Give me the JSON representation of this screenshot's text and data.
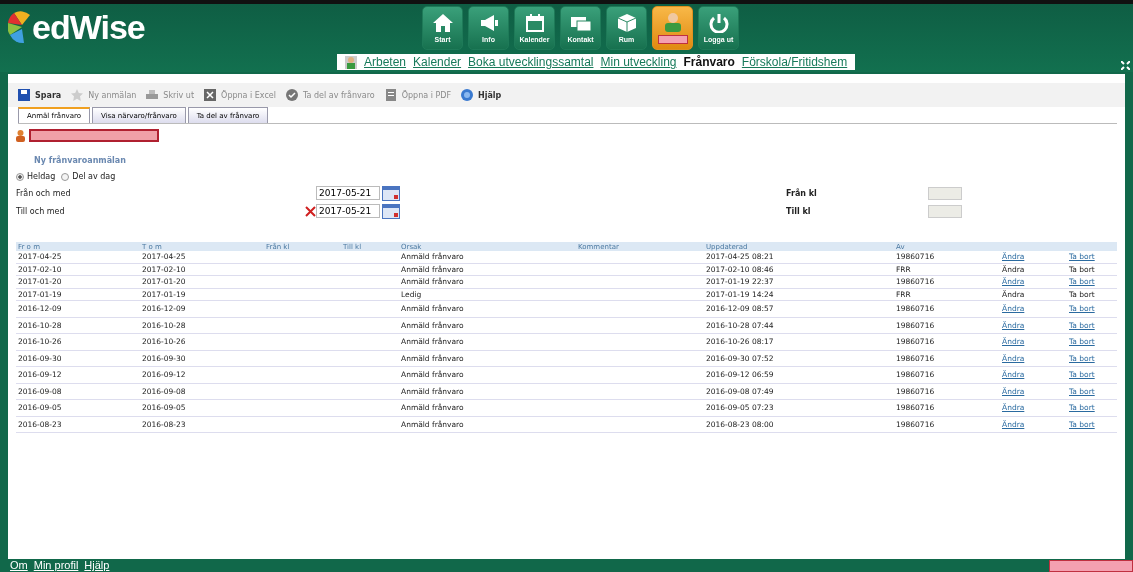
{
  "logo": "edWise",
  "nav_buttons": [
    {
      "label": "Start",
      "selected": false
    },
    {
      "label": "Info",
      "selected": false
    },
    {
      "label": "Kalender",
      "selected": false
    },
    {
      "label": "Kontakt",
      "selected": false
    },
    {
      "label": "Rum",
      "selected": false
    },
    {
      "selected": true
    },
    {
      "label": "Logga ut",
      "selected": false
    }
  ],
  "sub_nav": [
    {
      "label": "Arbeten",
      "selected": false
    },
    {
      "label": "Kalender",
      "selected": false
    },
    {
      "label": "Boka utvecklingssamtal",
      "selected": false
    },
    {
      "label": "Min utveckling",
      "selected": false
    },
    {
      "label": "Frånvaro",
      "selected": true
    },
    {
      "label": "Förskola/Fritidshem",
      "selected": false
    }
  ],
  "toolbar": [
    {
      "label": "Spara",
      "disabled": false
    },
    {
      "label": "Ny anmälan",
      "disabled": true
    },
    {
      "label": "Skriv ut",
      "disabled": true
    },
    {
      "label": "Öppna i Excel",
      "disabled": true
    },
    {
      "label": "Ta del av frånvaro",
      "disabled": true
    },
    {
      "label": "Öppna i PDF",
      "disabled": true
    },
    {
      "label": "Hjälp",
      "disabled": false
    }
  ],
  "tabs": [
    {
      "label": "Anmäl frånvaro",
      "selected": true
    },
    {
      "label": "Visa närvaro/frånvaro",
      "selected": false
    },
    {
      "label": "Ta del av frånvaro",
      "selected": false
    }
  ],
  "form": {
    "heading": "Ny frånvaroanmälan",
    "options": [
      {
        "label": "Heldag",
        "selected": true
      },
      {
        "label": "Del av dag",
        "selected": false
      }
    ],
    "from_label": "Från och med",
    "from_value": "2017-05-21",
    "to_label": "Till och med",
    "to_value": "2017-05-21",
    "from_time_label": "Från kl",
    "to_time_label": "Till kl"
  },
  "table": {
    "columns": [
      "Fr o m",
      "T o m",
      "Från kl",
      "Till kl",
      "Orsak",
      "Kommentar",
      "Uppdaterad",
      "Av"
    ],
    "rows": [
      {
        "from": "2017-04-25",
        "to": "2017-04-25",
        "reason": "Anmäld frånvaro",
        "updated": "2017-04-25 08:21",
        "by": "19860716",
        "edit": "Ändra",
        "remove": "Ta bort",
        "links": true
      },
      {
        "from": "2017-02-10",
        "to": "2017-02-10",
        "reason": "Anmäld frånvaro",
        "updated": "2017-02-10 08:46",
        "by": "FRR",
        "edit": "Ändra",
        "remove": "Ta bort",
        "links": false
      },
      {
        "from": "2017-01-20",
        "to": "2017-01-20",
        "reason": "Anmäld frånvaro",
        "updated": "2017-01-19 22:37",
        "by": "19860716",
        "edit": "Ändra",
        "remove": "Ta bort",
        "links": true
      },
      {
        "from": "2017-01-19",
        "to": "2017-01-19",
        "reason": "Ledig",
        "updated": "2017-01-19 14:24",
        "by": "FRR",
        "edit": "Ändra",
        "remove": "Ta bort",
        "links": false
      },
      {
        "from": "2016-12-09",
        "to": "2016-12-09",
        "reason": "Anmäld frånvaro",
        "updated": "2016-12-09 08:57",
        "by": "19860716",
        "edit": "Ändra",
        "remove": "Ta bort",
        "links": true
      },
      {
        "from": "2016-10-28",
        "to": "2016-10-28",
        "reason": "Anmäld frånvaro",
        "updated": "2016-10-28 07:44",
        "by": "19860716",
        "edit": "Ändra",
        "remove": "Ta bort",
        "links": true
      },
      {
        "from": "2016-10-26",
        "to": "2016-10-26",
        "reason": "Anmäld frånvaro",
        "updated": "2016-10-26 08:17",
        "by": "19860716",
        "edit": "Ändra",
        "remove": "Ta bort",
        "links": true
      },
      {
        "from": "2016-09-30",
        "to": "2016-09-30",
        "reason": "Anmäld frånvaro",
        "updated": "2016-09-30 07:52",
        "by": "19860716",
        "edit": "Ändra",
        "remove": "Ta bort",
        "links": true
      },
      {
        "from": "2016-09-12",
        "to": "2016-09-12",
        "reason": "Anmäld frånvaro",
        "updated": "2016-09-12 06:59",
        "by": "19860716",
        "edit": "Ändra",
        "remove": "Ta bort",
        "links": true
      },
      {
        "from": "2016-09-08",
        "to": "2016-09-08",
        "reason": "Anmäld frånvaro",
        "updated": "2016-09-08 07:49",
        "by": "19860716",
        "edit": "Ändra",
        "remove": "Ta bort",
        "links": true
      },
      {
        "from": "2016-09-05",
        "to": "2016-09-05",
        "reason": "Anmäld frånvaro",
        "updated": "2016-09-05 07:23",
        "by": "19860716",
        "edit": "Ändra",
        "remove": "Ta bort",
        "links": true
      },
      {
        "from": "2016-08-23",
        "to": "2016-08-23",
        "reason": "Anmäld frånvaro",
        "updated": "2016-08-23 08:00",
        "by": "19860716",
        "edit": "Ändra",
        "remove": "Ta bort",
        "links": true
      }
    ]
  },
  "footer_links": [
    "Om",
    "Min profil",
    "Hjälp"
  ]
}
